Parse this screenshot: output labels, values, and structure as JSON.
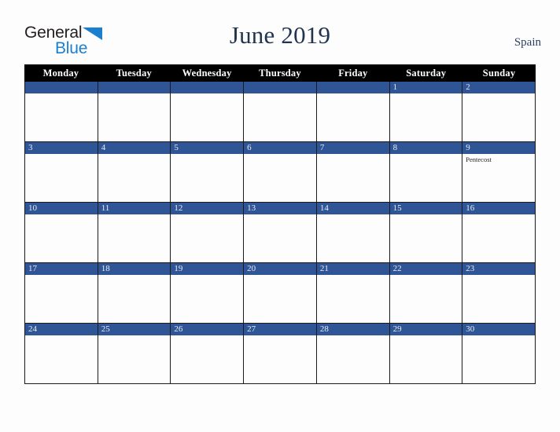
{
  "brand": {
    "name_part1": "General",
    "name_part2": "Blue",
    "triangle_color": "#1b7fd0",
    "text_color": "#231f20"
  },
  "header": {
    "title": "June 2019",
    "country": "Spain",
    "title_color": "#20344f"
  },
  "calendar": {
    "weekday_headers": [
      "Monday",
      "Tuesday",
      "Wednesday",
      "Thursday",
      "Friday",
      "Saturday",
      "Sunday"
    ],
    "header_background": "#000000",
    "header_text_color": "#ffffff",
    "date_band_color": "#2f5597",
    "date_text_color": "#e8edf5",
    "cell_background": "#fdfdfd",
    "border_color": "#1a1a1a",
    "weeks": [
      [
        {
          "date": "",
          "events": []
        },
        {
          "date": "",
          "events": []
        },
        {
          "date": "",
          "events": []
        },
        {
          "date": "",
          "events": []
        },
        {
          "date": "",
          "events": []
        },
        {
          "date": "1",
          "events": []
        },
        {
          "date": "2",
          "events": []
        }
      ],
      [
        {
          "date": "3",
          "events": []
        },
        {
          "date": "4",
          "events": []
        },
        {
          "date": "5",
          "events": []
        },
        {
          "date": "6",
          "events": []
        },
        {
          "date": "7",
          "events": []
        },
        {
          "date": "8",
          "events": []
        },
        {
          "date": "9",
          "events": [
            "Pentecost"
          ]
        }
      ],
      [
        {
          "date": "10",
          "events": []
        },
        {
          "date": "11",
          "events": []
        },
        {
          "date": "12",
          "events": []
        },
        {
          "date": "13",
          "events": []
        },
        {
          "date": "14",
          "events": []
        },
        {
          "date": "15",
          "events": []
        },
        {
          "date": "16",
          "events": []
        }
      ],
      [
        {
          "date": "17",
          "events": []
        },
        {
          "date": "18",
          "events": []
        },
        {
          "date": "19",
          "events": []
        },
        {
          "date": "20",
          "events": []
        },
        {
          "date": "21",
          "events": []
        },
        {
          "date": "22",
          "events": []
        },
        {
          "date": "23",
          "events": []
        }
      ],
      [
        {
          "date": "24",
          "events": []
        },
        {
          "date": "25",
          "events": []
        },
        {
          "date": "26",
          "events": []
        },
        {
          "date": "27",
          "events": []
        },
        {
          "date": "28",
          "events": []
        },
        {
          "date": "29",
          "events": []
        },
        {
          "date": "30",
          "events": []
        }
      ]
    ]
  }
}
